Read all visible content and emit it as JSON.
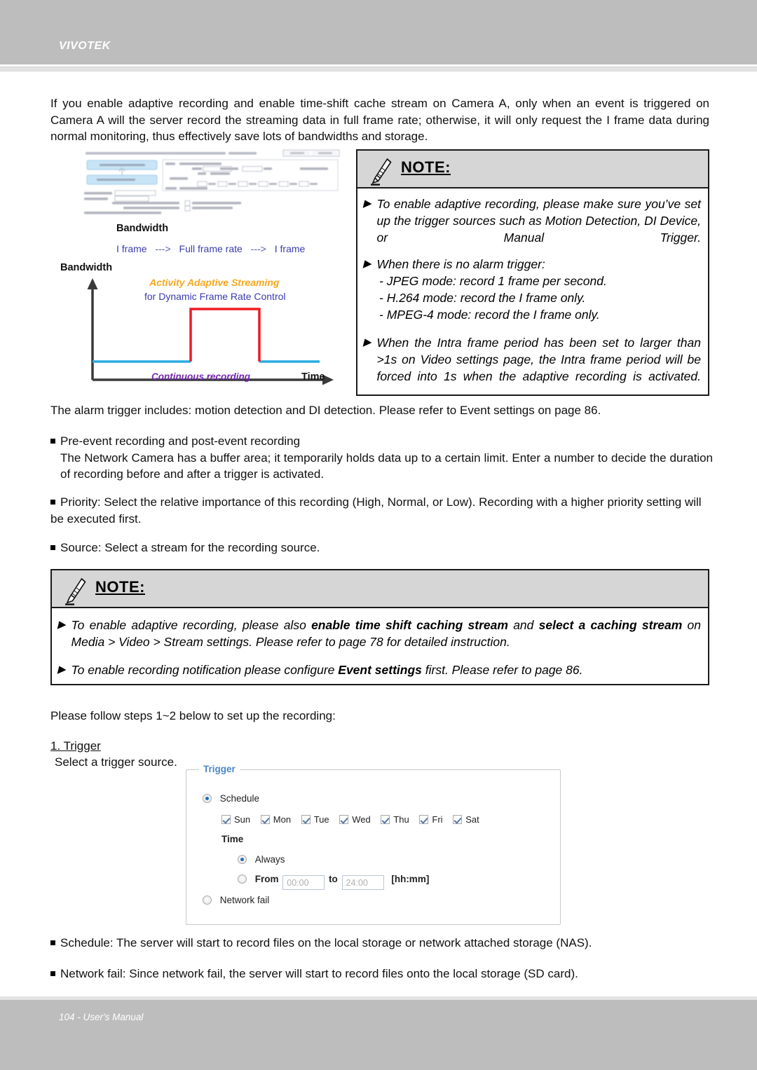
{
  "header": {
    "brand": "VIVOTEK"
  },
  "footer": {
    "text": "104 - User's Manual"
  },
  "intro_paragraph": "If you enable adaptive recording and enable time-shift cache stream on Camera A, only when an event is triggered on Camera A will the server record the streaming data in full frame rate; otherwise, it will only request the I frame data during normal monitoring, thus effectively save lots of bandwidths and storage.",
  "figure": {
    "bandwidth_heading": "Bandwidth",
    "frame_sequence": {
      "left": "I frame",
      "arrow1": "--->",
      "middle": "Full frame rate",
      "arrow2": "--->",
      "right": "I frame"
    },
    "y_axis_label": "Bandwidth",
    "x_axis_label": "Time",
    "annotation_primary": "Activity Adaptive Streaming",
    "annotation_secondary": "for Dynamic Frame Rate Control",
    "annotation_baseline": "Continuous recording",
    "colors": {
      "baseline": "#29abe2",
      "pulse": "#ed1c24",
      "axis": "#3a3a3a",
      "orange": "#f7a71c",
      "purple": "#7427b0",
      "blue_text": "#3b3bb0"
    }
  },
  "chart_data": {
    "type": "line",
    "title": "Bandwidth",
    "xlabel": "Time",
    "ylabel": "Bandwidth",
    "xlim": [
      0,
      10
    ],
    "ylim": [
      0,
      10
    ],
    "grid": false,
    "legend_position": "none",
    "annotations": [
      "Activity Adaptive Streaming",
      "for Dynamic Frame Rate Control",
      "Continuous recording",
      "I frame ---> Full frame rate ---> I frame"
    ],
    "series": [
      {
        "name": "Continuous recording",
        "color": "#29abe2",
        "x": [
          0.3,
          4.2,
          7.9,
          10.0
        ],
        "values": [
          1.5,
          1.5,
          1.5,
          1.5
        ]
      },
      {
        "name": "Activity Adaptive Streaming",
        "color": "#ed1c24",
        "x": [
          4.2,
          4.2,
          7.9,
          7.9
        ],
        "values": [
          1.5,
          7.3,
          7.3,
          1.5
        ]
      }
    ]
  },
  "note1": {
    "title": "NOTE:",
    "icon": "pencil-icon",
    "bullets": [
      {
        "marker": "▶",
        "text": "To enable adaptive recording, please make sure you’ve set up the trigger sources such as Motion Detection, DI Device, or Manual Trigger."
      },
      {
        "marker": "▶",
        "text": "When there is no alarm trigger:"
      }
    ],
    "sub_lines": [
      "- JPEG mode: record 1 frame per second.",
      "- H.264 mode: record the I frame only.",
      "- MPEG-4 mode: record the I frame only."
    ],
    "bullet3": {
      "marker": "▶",
      "text": "When the Intra frame period has been set to larger than >1s on Video settings page, the Intra frame period will be forced into 1s when the adaptive recording is activated."
    }
  },
  "body": {
    "alarm_line": "The alarm trigger includes: motion detection and DI detection. Please refer to Event settings on page 86.",
    "bullet_pre_event_title": "Pre-event recording and post-event recording",
    "bullet_pre_event_text": "The Network Camera has a buffer area; it temporarily holds data up to a certain limit. Enter a number to decide the duration of recording before and after a trigger is activated.",
    "bullet_priority": "Priority: Select the relative importance of this recording (High, Normal, or Low). Recording with a higher priority setting will be executed first.",
    "bullet_source": "Source: Select a stream for the recording source.",
    "steps_intro": "Please follow steps 1~2 below to set up the recording:",
    "step1_title": "1. Trigger",
    "step1_sub": "Select a trigger source.",
    "bullet_schedule": "Schedule: The server will start to record files on the local storage or network attached storage (NAS).",
    "bullet_network_fail": "Network fail: Since network fail, the server will start to record files onto the local storage (SD card)."
  },
  "note2": {
    "title": "NOTE:",
    "icon": "pencil-icon",
    "bullet1": {
      "marker": "▶",
      "part1": "To enable adaptive recording, please also ",
      "bold1": "enable time shift caching stream",
      "part2": " and ",
      "bold2": "select a caching stream",
      "part3": " on Media > Video > Stream settings. Please refer to page 78 for detailed instruction."
    },
    "bullet2": {
      "marker": "▶",
      "part1": "To enable recording notification please configure ",
      "bold1": "Event settings",
      "part2": " first. Please refer to page 86."
    }
  },
  "trigger_panel": {
    "legend": "Trigger",
    "schedule_label": "Schedule",
    "schedule_selected": true,
    "days": [
      {
        "label": "Sun",
        "checked": true
      },
      {
        "label": "Mon",
        "checked": true
      },
      {
        "label": "Tue",
        "checked": true
      },
      {
        "label": "Wed",
        "checked": true
      },
      {
        "label": "Thu",
        "checked": true
      },
      {
        "label": "Fri",
        "checked": true
      },
      {
        "label": "Sat",
        "checked": true
      }
    ],
    "time_label": "Time",
    "always_label": "Always",
    "always_selected": true,
    "from_label": "From",
    "from_value": "00:00",
    "to_label": "to",
    "to_value": "24:00",
    "format_hint": "[hh:mm]",
    "network_fail_label": "Network fail",
    "network_fail_selected": false
  }
}
